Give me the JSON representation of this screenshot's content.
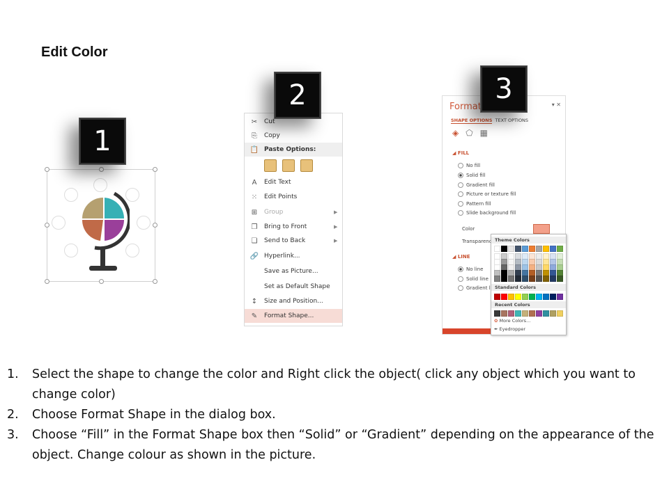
{
  "title": "Edit Color",
  "badges": [
    "1",
    "2",
    "3"
  ],
  "context_menu": {
    "items": [
      {
        "icon": "scissors-icon",
        "glyph": "✂",
        "label": "Cut"
      },
      {
        "icon": "copy-icon",
        "glyph": "⎘",
        "label": "Copy"
      },
      {
        "icon": "clipboard-icon",
        "glyph": "📋",
        "label": "Paste Options:",
        "header": true
      },
      {
        "icon": "edit-text-icon",
        "glyph": "A",
        "label": "Edit Text"
      },
      {
        "icon": "edit-points-icon",
        "glyph": "⁙",
        "label": "Edit Points"
      },
      {
        "icon": "group-icon",
        "glyph": "⊞",
        "label": "Group",
        "submenu": true,
        "disabled": true
      },
      {
        "icon": "bring-front-icon",
        "glyph": "❐",
        "label": "Bring to Front",
        "submenu": true
      },
      {
        "icon": "send-back-icon",
        "glyph": "❏",
        "label": "Send to Back",
        "submenu": true
      },
      {
        "icon": "hyperlink-icon",
        "glyph": "🔗",
        "label": "Hyperlink..."
      },
      {
        "icon": "",
        "glyph": "",
        "label": "Save as Picture..."
      },
      {
        "icon": "",
        "glyph": "",
        "label": "Set as Default Shape"
      },
      {
        "icon": "size-position-icon",
        "glyph": "↕",
        "label": "Size and Position..."
      },
      {
        "icon": "format-shape-icon",
        "glyph": "✎",
        "label": "Format Shape...",
        "highlighted": true
      }
    ]
  },
  "format_pane": {
    "title": "Format S",
    "tabs": [
      "SHAPE OPTIONS",
      "TEXT OPTIONS"
    ],
    "fill_section": "FILL",
    "fill_options": [
      {
        "label": "No fill",
        "selected": false
      },
      {
        "label": "Solid fill",
        "selected": true
      },
      {
        "label": "Gradient fill",
        "selected": false
      },
      {
        "label": "Picture or texture fill",
        "selected": false
      },
      {
        "label": "Pattern fill",
        "selected": false
      },
      {
        "label": "Slide background fill",
        "selected": false
      }
    ],
    "color_label": "Color",
    "transparency_label": "Transparency",
    "line_section": "LINE",
    "line_options": [
      {
        "label": "No line",
        "selected": true
      },
      {
        "label": "Solid line",
        "selected": false
      },
      {
        "label": "Gradient line",
        "selected": false
      }
    ]
  },
  "palette": {
    "theme_label": "Theme Colors",
    "theme_colors": [
      "#ffffff",
      "#000000",
      "#e7e6e6",
      "#44546a",
      "#5b9bd5",
      "#ed7d31",
      "#a5a5a5",
      "#ffc000",
      "#4472c4",
      "#70ad47"
    ],
    "standard_label": "Standard Colors",
    "standard_colors": [
      "#c00000",
      "#ff0000",
      "#ffc000",
      "#ffff00",
      "#92d050",
      "#00b050",
      "#00b0f0",
      "#0070c0",
      "#002060",
      "#7030a0"
    ],
    "recent_label": "Recent Colors",
    "recent_colors": [
      "#3a3a3a",
      "#a87560",
      "#b0607a",
      "#3fb5b5",
      "#c4b07a",
      "#b07050",
      "#9040a0",
      "#3090a0",
      "#b0a060",
      "#f0d060"
    ],
    "more_colors": "More Colors...",
    "eyedropper": "Eyedropper"
  },
  "steps": [
    {
      "num": "1.",
      "text": "Select the shape to change the color and Right click the object( click any object which you want to change color)"
    },
    {
      "num": "2.",
      "text": "Choose Format Shape in the dialog box."
    },
    {
      "num": "3.",
      "text": "Choose “Fill” in the Format Shape box then “Solid” or “Gradient” depending on the appearance of the object. Change colour as shown in the picture."
    }
  ]
}
